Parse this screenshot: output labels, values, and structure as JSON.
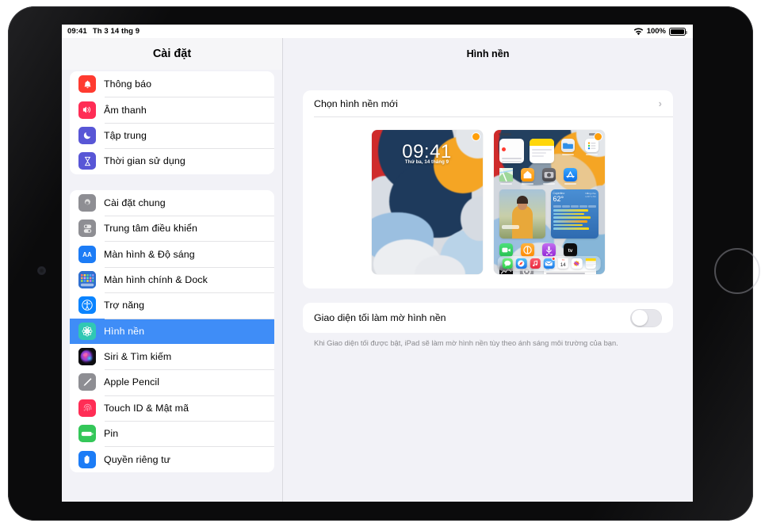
{
  "device": {
    "name": "ipad",
    "camera": "front-camera",
    "home_indicator": "home-ring"
  },
  "status_bar": {
    "time": "09:41",
    "date": "Th 3 14 thg 9",
    "wifi_icon": "wifi-icon",
    "battery_percent": "100%",
    "battery_icon": "battery-icon"
  },
  "sidebar": {
    "title": "Cài đặt",
    "groups": [
      {
        "items": [
          {
            "label": "Thông báo",
            "icon": "bell-icon",
            "icon_bg": "#ff3b30",
            "selected": false
          },
          {
            "label": "Âm thanh",
            "icon": "speaker-icon",
            "icon_bg": "#ff2d55",
            "selected": false
          },
          {
            "label": "Tập trung",
            "icon": "moon-icon",
            "icon_bg": "#5856d6",
            "selected": false
          },
          {
            "label": "Thời gian sử dụng",
            "icon": "hourglass-icon",
            "icon_bg": "#5856d6",
            "selected": false
          }
        ]
      },
      {
        "items": [
          {
            "label": "Cài đặt chung",
            "icon": "gear-icon",
            "icon_bg": "#8e8e93",
            "selected": false
          },
          {
            "label": "Trung tâm điều khiển",
            "icon": "control-center-icon",
            "icon_bg": "#8e8e93",
            "selected": false
          },
          {
            "label": "Màn hình & Độ sáng",
            "icon": "display-brightness-icon",
            "icon_bg": "#1c7cf6",
            "selected": false
          },
          {
            "label": "Màn hình chính & Dock",
            "icon": "home-screen-dock-icon",
            "icon_bg": "#2f6fd0",
            "selected": false
          },
          {
            "label": "Trợ năng",
            "icon": "accessibility-icon",
            "icon_bg": "#0a84ff",
            "selected": false
          },
          {
            "label": "Hình nền",
            "icon": "wallpaper-flower-icon",
            "icon_bg": "#30c8b4",
            "selected": true
          },
          {
            "label": "Siri & Tìm kiếm",
            "icon": "siri-icon",
            "icon_bg": "#1c1c1e",
            "selected": false
          },
          {
            "label": "Apple Pencil",
            "icon": "pencil-icon",
            "icon_bg": "#8e8e93",
            "selected": false
          },
          {
            "label": "Touch ID & Mật mã",
            "icon": "fingerprint-icon",
            "icon_bg": "#ff2d55",
            "selected": false
          },
          {
            "label": "Pin",
            "icon": "battery-green-icon",
            "icon_bg": "#34c759",
            "selected": false
          },
          {
            "label": "Quyền riêng tư",
            "icon": "privacy-hand-icon",
            "icon_bg": "#1c7cf6",
            "selected": false
          }
        ]
      }
    ]
  },
  "detail": {
    "title": "Hình nền",
    "choose_row": {
      "label": "Chọn hình nền mới",
      "chevron_icon": "chevron-right-icon"
    },
    "previews": [
      {
        "name": "lock-screen-preview",
        "time": "09:41",
        "date": "Thứ ba, 14 tháng 9",
        "badge": "selected-badge"
      },
      {
        "name": "home-screen-preview",
        "badge": "selected-badge"
      }
    ],
    "dark_mode_row": {
      "label": "Giao diện tối làm mờ hình nền",
      "toggle_name": "dark-appearance-dims-wallpaper-toggle",
      "toggle_on": false
    },
    "footnote": "Khi Giao diện tối được bật, iPad sẽ làm mờ hình nền tùy theo ánh sáng môi trường của bạn."
  },
  "colors": {
    "selection_blue": "#3f8df7",
    "screen_bg": "#f2f2f7",
    "card_white": "#ffffff",
    "separator": "#e3e3e6",
    "footnote_gray": "#8a8a8e"
  }
}
